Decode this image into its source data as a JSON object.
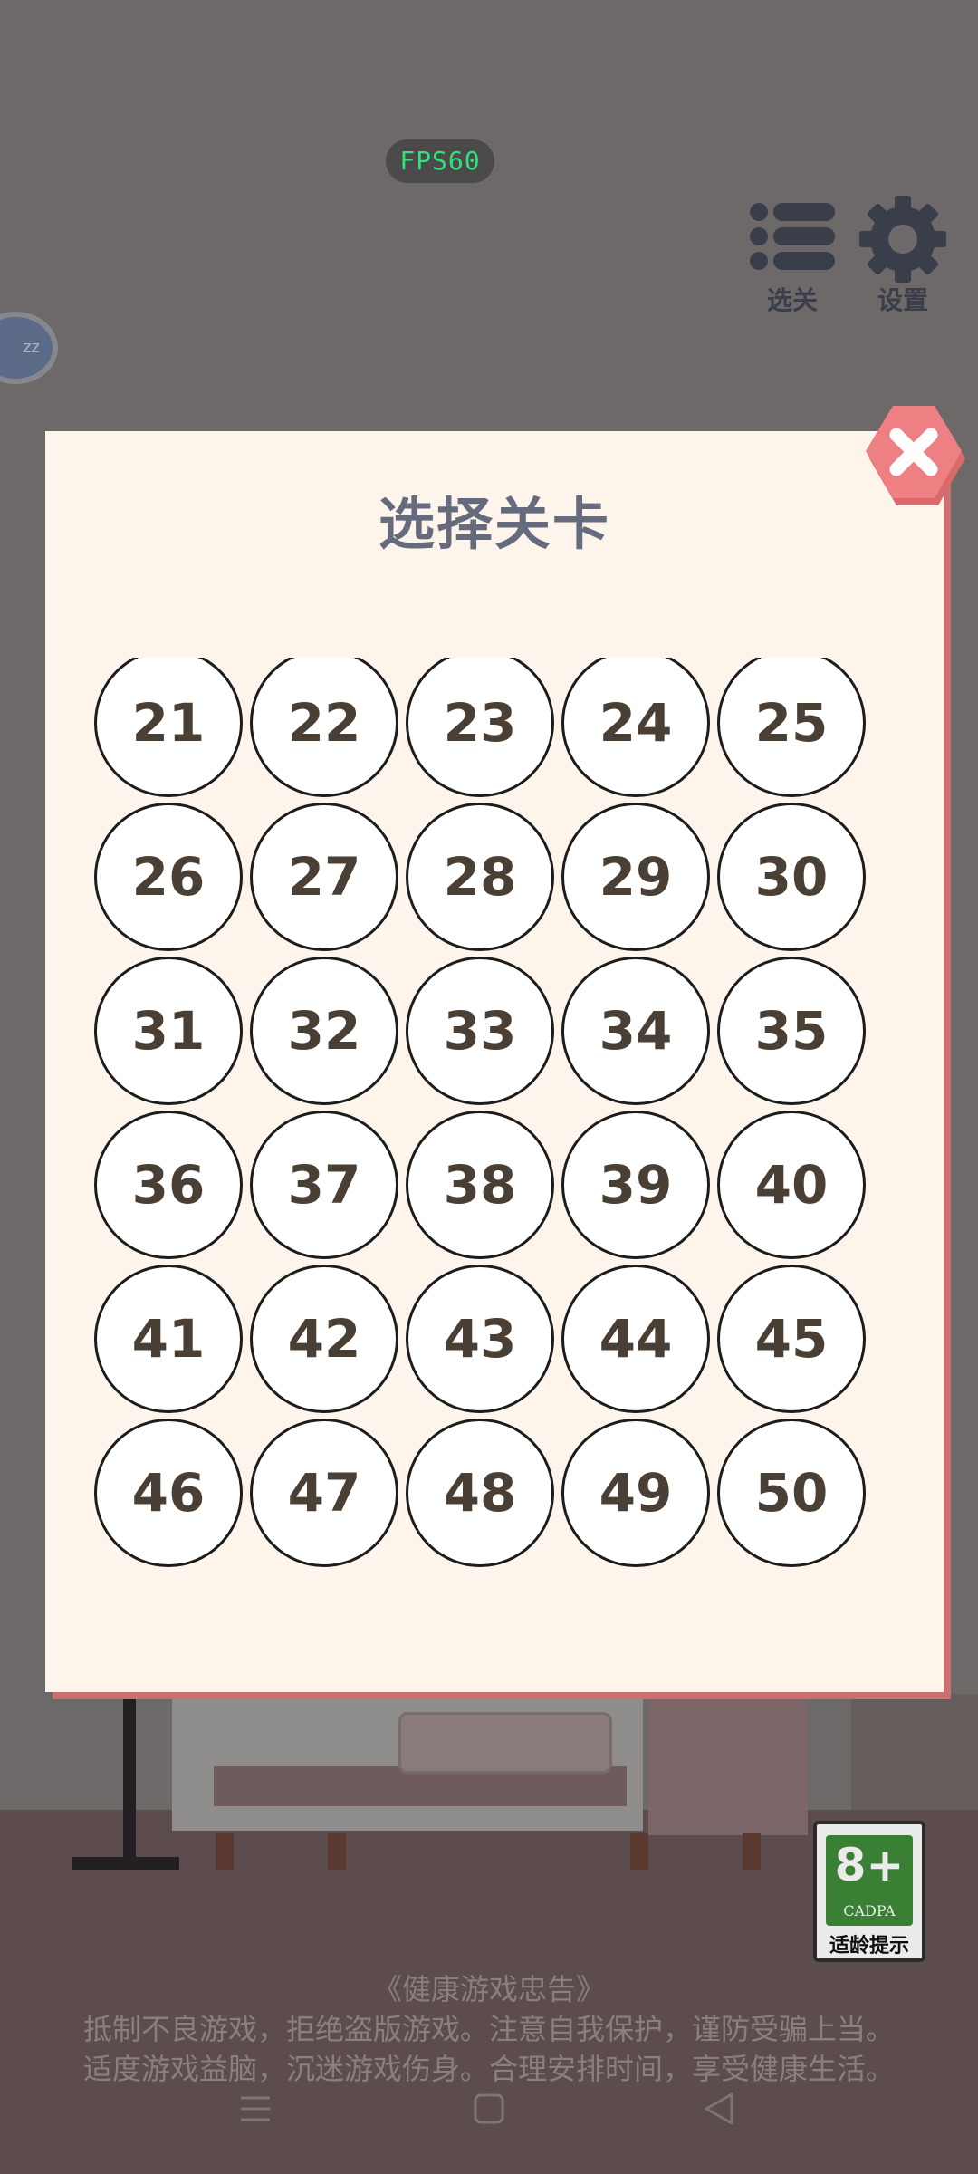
{
  "hud": {
    "fps": "FPS60",
    "level_select_label": "选关",
    "settings_label": "设置",
    "sleep_badge": "zz"
  },
  "modal": {
    "title": "选择关卡",
    "levels": [
      "21",
      "22",
      "23",
      "24",
      "25",
      "26",
      "27",
      "28",
      "29",
      "30",
      "31",
      "32",
      "33",
      "34",
      "35",
      "36",
      "37",
      "38",
      "39",
      "40",
      "41",
      "42",
      "43",
      "44",
      "45",
      "46",
      "47",
      "48",
      "49",
      "50"
    ]
  },
  "age_rating": {
    "value": "8+",
    "org": "CADPA",
    "caption": "适龄提示"
  },
  "health_notice": {
    "title": "《健康游戏忠告》",
    "line1": "抵制不良游戏，拒绝盗版游戏。注意自我保护，谨防受骗上当。",
    "line2": "适度游戏益脑，沉迷游戏伤身。合理安排时间，享受健康生活。"
  },
  "colors": {
    "close_red": "#e8777a",
    "title_gray": "#656a7c",
    "level_text": "#4a3f35",
    "fps_green": "#34e07a"
  },
  "icons": {
    "level_select": "list-icon",
    "settings": "gear-icon",
    "close": "close-icon"
  }
}
